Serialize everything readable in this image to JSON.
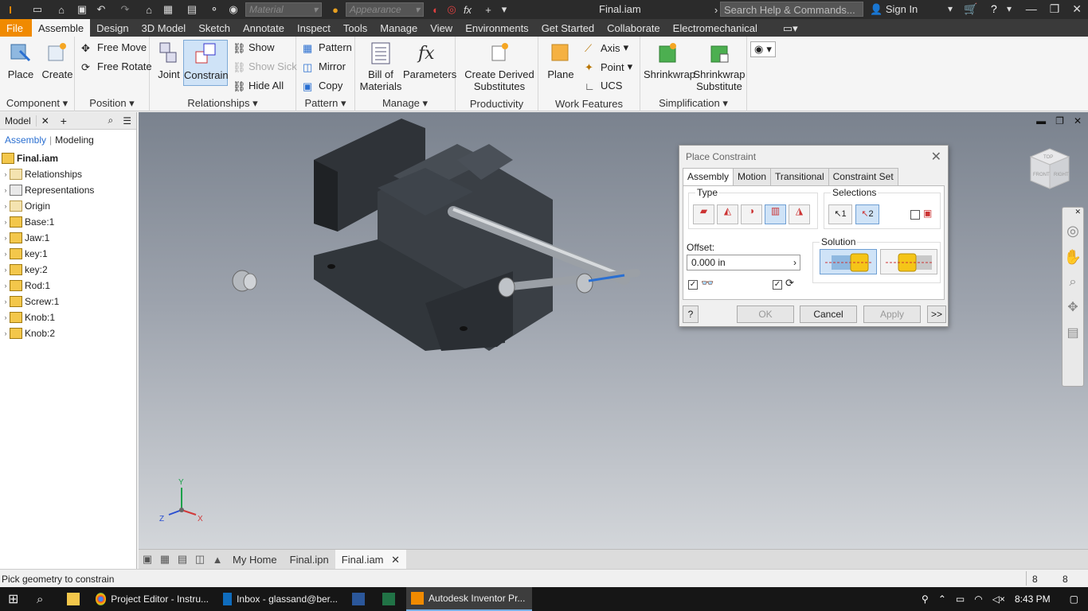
{
  "titlebar": {
    "material_placeholder": "Material",
    "appearance_placeholder": "Appearance",
    "document_title": "Final.iam",
    "search_placeholder": "Search Help & Commands...",
    "signin_label": "Sign In"
  },
  "ribbon_tabs": [
    "File",
    "Assemble",
    "Design",
    "3D Model",
    "Sketch",
    "Annotate",
    "Inspect",
    "Tools",
    "Manage",
    "View",
    "Environments",
    "Get Started",
    "Collaborate",
    "Electromechanical"
  ],
  "ribbon": {
    "component": {
      "title": "Component",
      "place": "Place",
      "create": "Create"
    },
    "position": {
      "title": "Position",
      "free_move": "Free Move",
      "free_rotate": "Free Rotate"
    },
    "relationships": {
      "title": "Relationships",
      "joint": "Joint",
      "constrain": "Constrain",
      "show": "Show",
      "show_sick": "Show Sick",
      "hide_all": "Hide All"
    },
    "pattern": {
      "title": "Pattern",
      "pattern": "Pattern",
      "mirror": "Mirror",
      "copy": "Copy"
    },
    "manage": {
      "title": "Manage",
      "bom_line1": "Bill of",
      "bom_line2": "Materials",
      "parameters": "Parameters"
    },
    "productivity": {
      "title": "Productivity",
      "cds_line1": "Create Derived",
      "cds_line2": "Substitutes"
    },
    "work_features": {
      "title": "Work Features",
      "plane": "Plane",
      "axis": "Axis",
      "point": "Point",
      "ucs": "UCS"
    },
    "simplification": {
      "title": "Simplification",
      "shrinkwrap": "Shrinkwrap",
      "shrinkwrap_sub_line1": "Shrinkwrap",
      "shrinkwrap_sub_line2": "Substitute"
    }
  },
  "browser": {
    "tab_label": "Model",
    "mode_assembly": "Assembly",
    "mode_modeling": "Modeling",
    "root": "Final.iam",
    "items": [
      "Relationships",
      "Representations",
      "Origin",
      "Base:1",
      "Jaw:1",
      "key:1",
      "key:2",
      "Rod:1",
      "Screw:1",
      "Knob:1",
      "Knob:2"
    ]
  },
  "dialog": {
    "title": "Place Constraint",
    "tabs": [
      "Assembly",
      "Motion",
      "Transitional",
      "Constraint Set"
    ],
    "type_label": "Type",
    "selections_label": "Selections",
    "sel1": "1",
    "sel2": "2",
    "offset_label": "Offset:",
    "offset_value": "0.000 in",
    "solution_label": "Solution",
    "ok": "OK",
    "cancel": "Cancel",
    "apply": "Apply",
    "more": ">>",
    "help": "?"
  },
  "viewcube": {
    "top": "TOP",
    "front": "FRONT",
    "right": "RIGHT"
  },
  "axes": {
    "x": "X",
    "y": "Y",
    "z": "Z"
  },
  "doc_tabs": [
    "My Home",
    "Final.ipn",
    "Final.iam"
  ],
  "status": {
    "message": "Pick geometry to constrain",
    "count1": "8",
    "count2": "8"
  },
  "taskbar": {
    "items": [
      "Project Editor - Instru...",
      "Inbox - glassand@ber...",
      "Autodesk Inventor Pr..."
    ],
    "time": "8:43 PM"
  },
  "colors": {
    "file_tab": "#f08a00",
    "accent": "#2a6fd1",
    "selection": "#cfe3f7"
  }
}
